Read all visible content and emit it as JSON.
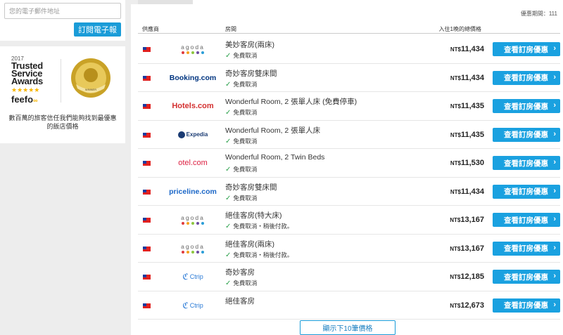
{
  "sidebar": {
    "email_placeholder": "您的電子郵件地址",
    "subscribe_label": "訂閱電子報",
    "award": {
      "year": "2017",
      "title_line1": "Trusted",
      "title_line2": "Service",
      "title_line3": "Awards",
      "stars": "★★★★★",
      "brand": "feefo",
      "medal_text": "World's Leading Hotel Comparison Website",
      "description": "數百萬的旅客信任我們能夠找到最優惠的飯店價格"
    }
  },
  "main": {
    "disclaimer": "優惠期間：111",
    "columns": {
      "provider": "供應商",
      "room": "房間",
      "price": "入住1晚的總價格"
    },
    "currency": "NT$",
    "deal_button_label": "查看訂房優惠",
    "deal_button_arrow": "›",
    "more_button_label": "顯示下10筆價格",
    "offers": [
      {
        "provider": "agoda",
        "room": "美妙客房(兩床)",
        "cancel": "免費取消",
        "price": "11,434"
      },
      {
        "provider": "Booking.com",
        "room": "奇妙客房雙床間",
        "cancel": "免費取消",
        "price": "11,434"
      },
      {
        "provider": "Hotels.com",
        "room": "Wonderful Room, 2 張單人床 (免費停車)",
        "cancel": "免費取消",
        "price": "11,435"
      },
      {
        "provider": "Expedia",
        "room": "Wonderful Room, 2 張單人床",
        "cancel": "免費取消",
        "price": "11,435"
      },
      {
        "provider": "otel.com",
        "room": "Wonderful Room, 2 Twin Beds",
        "cancel": "免費取消",
        "price": "11,530"
      },
      {
        "provider": "priceline.com",
        "room": "奇妙客房雙床間",
        "cancel": "免費取消",
        "price": "11,434"
      },
      {
        "provider": "agoda",
        "room": "絕佳客房(特大床)",
        "cancel": "免費取消・稍後付款。",
        "price": "13,167"
      },
      {
        "provider": "agoda",
        "room": "絕佳客房(兩床)",
        "cancel": "免費取消・稍後付款。",
        "price": "13,167"
      },
      {
        "provider": "Ctrip",
        "room": "奇妙客房",
        "cancel": "免費取消",
        "price": "12,185"
      },
      {
        "provider": "Ctrip",
        "room": "絕佳客房",
        "cancel": "",
        "price": "12,673"
      }
    ],
    "colors": {
      "accent": "#1aa1e0",
      "check": "#2aa04a",
      "flag_red": "#e0201f",
      "flag_blue": "#1d3a9e"
    }
  }
}
